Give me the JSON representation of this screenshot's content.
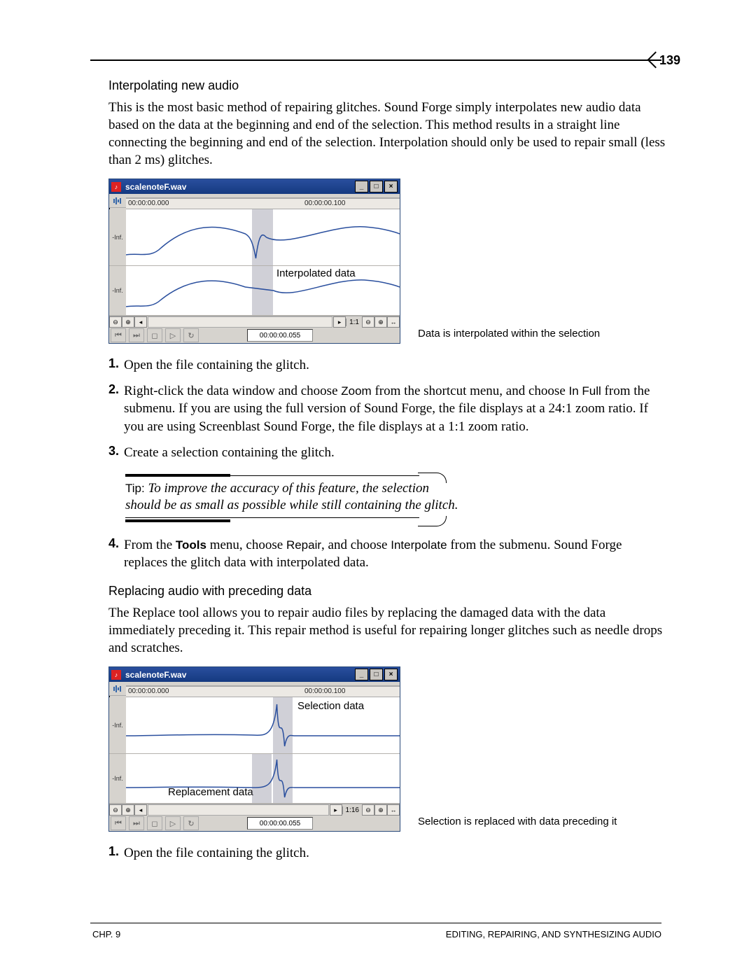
{
  "page_number": "139",
  "section1": {
    "heading": "Interpolating new audio",
    "intro": "This is the most basic method of repairing glitches. Sound Forge simply interpolates new audio data based on the data at the beginning and end of the selection. This method results in a straight line connecting the beginning and end of the selection. Interpolation should only be used to repair small (less than 2 ms) glitches."
  },
  "figure1": {
    "window_title": "scalenoteF.wav",
    "ruler_start": "00:00:00.000",
    "ruler_end": "00:00:00.100",
    "channel_label": "-Inf.",
    "overlay_label": "Interpolated data",
    "zoom_ratio": "1:1",
    "time_value": "00:00:00.055",
    "caption": "Data is interpolated within the selection"
  },
  "steps1": {
    "s1": "Open the file containing the glitch.",
    "s2a": "Right-click the data window and choose ",
    "s2_zoom": "Zoom",
    "s2b": " from the shortcut menu, and choose ",
    "s2_infull": "In Full",
    "s2c": " from the submenu. If you are using the full version of Sound Forge, the file displays at a 24:1 zoom ratio. If you are using Screenblast Sound Forge, the file displays at a 1:1 zoom ratio.",
    "s3": "Create a selection containing the glitch.",
    "tip_label": "Tip: ",
    "tip_text": "To improve the accuracy of this feature, the selection should be as small as possible while still containing the glitch.",
    "s4a": "From the ",
    "s4_tools": "Tools",
    "s4b": " menu, choose ",
    "s4_repair": "Repair",
    "s4c": ", and choose ",
    "s4_interpolate": "Interpolate",
    "s4d": " from the submenu. Sound Forge replaces the glitch data with interpolated data."
  },
  "section2": {
    "heading": "Replacing audio with preceding data",
    "intro": "The Replace tool allows you to repair audio files by replacing the damaged data with the data immediately preceding it. This repair method is useful for repairing longer glitches such as needle drops and scratches."
  },
  "figure2": {
    "window_title": "scalenoteF.wav",
    "ruler_start": "00:00:00.000",
    "ruler_end": "00:00:00.100",
    "channel_label": "-Inf.",
    "overlay_label_sel": "Selection data",
    "overlay_label_rep": "Replacement data",
    "zoom_ratio": "1:16",
    "time_value": "00:00:00.055",
    "caption": "Selection is replaced with data preceding it"
  },
  "steps2": {
    "s1": "Open the file containing the glitch."
  },
  "footer": {
    "left": "CHP. 9",
    "right": "EDITING, REPAIRING, AND SYNTHESIZING AUDIO"
  },
  "nums": {
    "n1": "1.",
    "n2": "2.",
    "n3": "3.",
    "n4": "4."
  },
  "winbtns": {
    "min": "_",
    "max": "□",
    "close": "×"
  }
}
